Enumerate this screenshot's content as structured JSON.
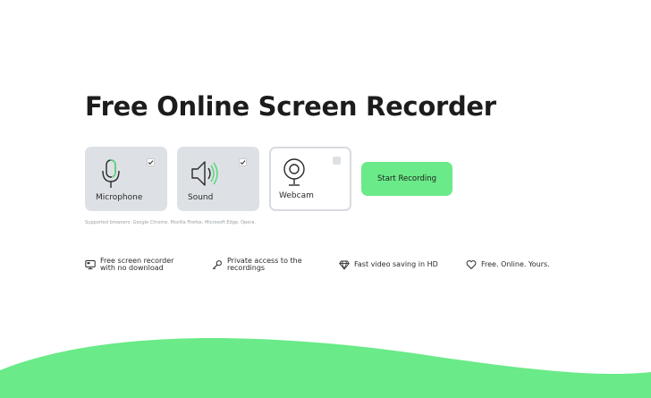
{
  "hero": {
    "title": "Free Online Screen Recorder"
  },
  "options": [
    {
      "label": "Microphone",
      "checked": true,
      "icon": "microphone-icon"
    },
    {
      "label": "Sound",
      "checked": true,
      "icon": "speaker-icon"
    },
    {
      "label": "Webcam",
      "checked": false,
      "icon": "webcam-icon"
    }
  ],
  "actions": {
    "start_label": "Start Recording"
  },
  "note": {
    "browsers": "Supported browsers: Google Chrome, Mozilla Firefox, Microsoft Edge, Opera."
  },
  "features": [
    {
      "line1": "Free screen recorder",
      "line2": "with no download",
      "icon": "monitor-icon"
    },
    {
      "line1": "Private access to the",
      "line2": "recordings",
      "icon": "key-icon"
    },
    {
      "line1": "Fast video saving in HD",
      "line2": "",
      "icon": "diamond-icon"
    },
    {
      "line1": "Free. Online. Yours.",
      "line2": "",
      "icon": "heart-icon"
    }
  ],
  "colors": {
    "accent": "#6aea88",
    "card_bg": "#dde1e6",
    "text": "#1c1c1c"
  }
}
